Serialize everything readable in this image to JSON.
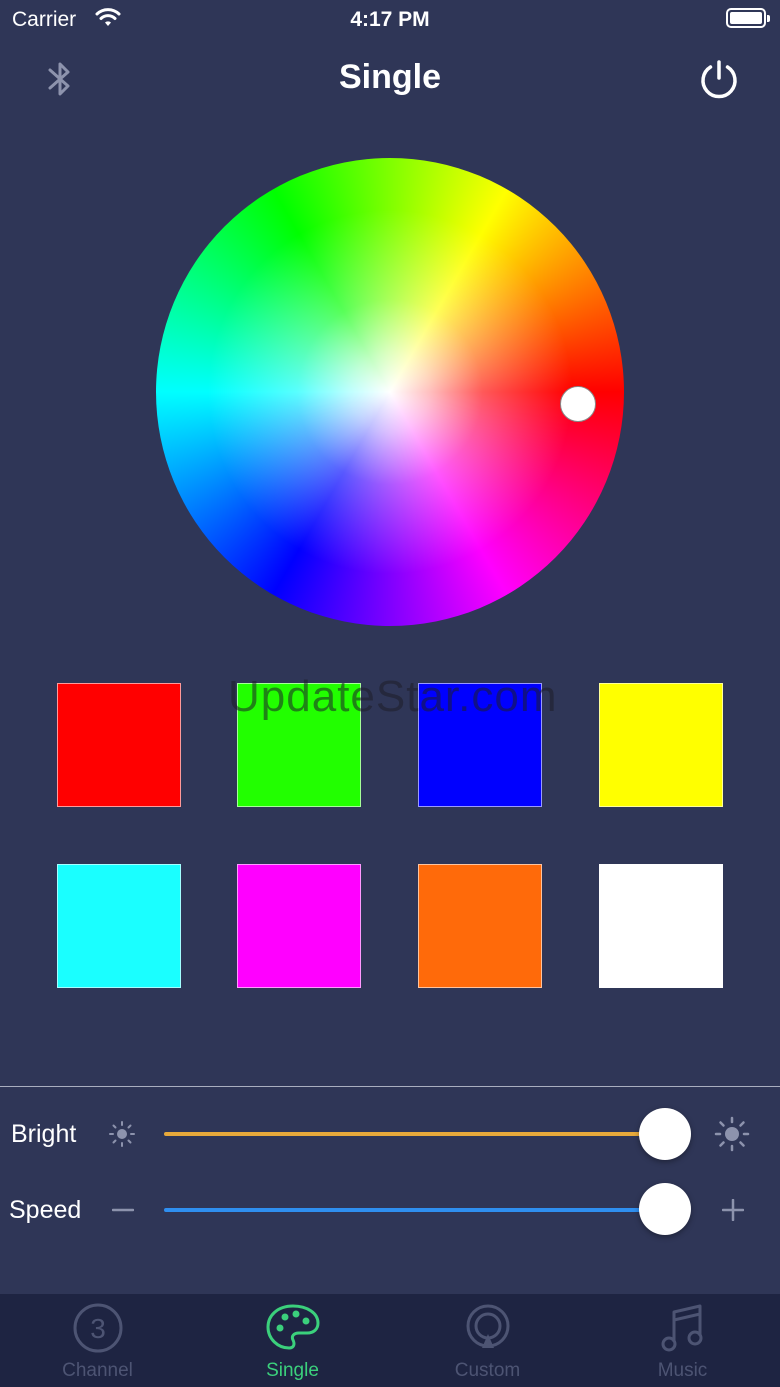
{
  "status_bar": {
    "carrier": "Carrier",
    "time": "4:17 PM"
  },
  "nav": {
    "title": "Single"
  },
  "color_wheel": {
    "selected_hue": "red"
  },
  "swatches": [
    {
      "name": "red",
      "color": "#ff0000"
    },
    {
      "name": "green",
      "color": "#22ff00"
    },
    {
      "name": "blue",
      "color": "#0000ff"
    },
    {
      "name": "yellow",
      "color": "#ffff00"
    },
    {
      "name": "cyan",
      "color": "#1affff"
    },
    {
      "name": "magenta",
      "color": "#ff00ff"
    },
    {
      "name": "orange",
      "color": "#ff6a0a"
    },
    {
      "name": "white",
      "color": "#ffffff"
    }
  ],
  "watermark": "UpdateStar.com",
  "sliders": {
    "bright": {
      "label": "Bright",
      "value_fraction": 1.0,
      "color": "#e7a93b"
    },
    "speed": {
      "label": "Speed",
      "value_fraction": 1.0,
      "color": "#2f8ff0"
    }
  },
  "tabs": [
    {
      "label": "Channel",
      "icon": "channel-3-icon",
      "active": false
    },
    {
      "label": "Single",
      "icon": "palette-icon",
      "active": true
    },
    {
      "label": "Custom",
      "icon": "custom-ring-icon",
      "active": false
    },
    {
      "label": "Music",
      "icon": "music-note-icon",
      "active": false
    }
  ]
}
